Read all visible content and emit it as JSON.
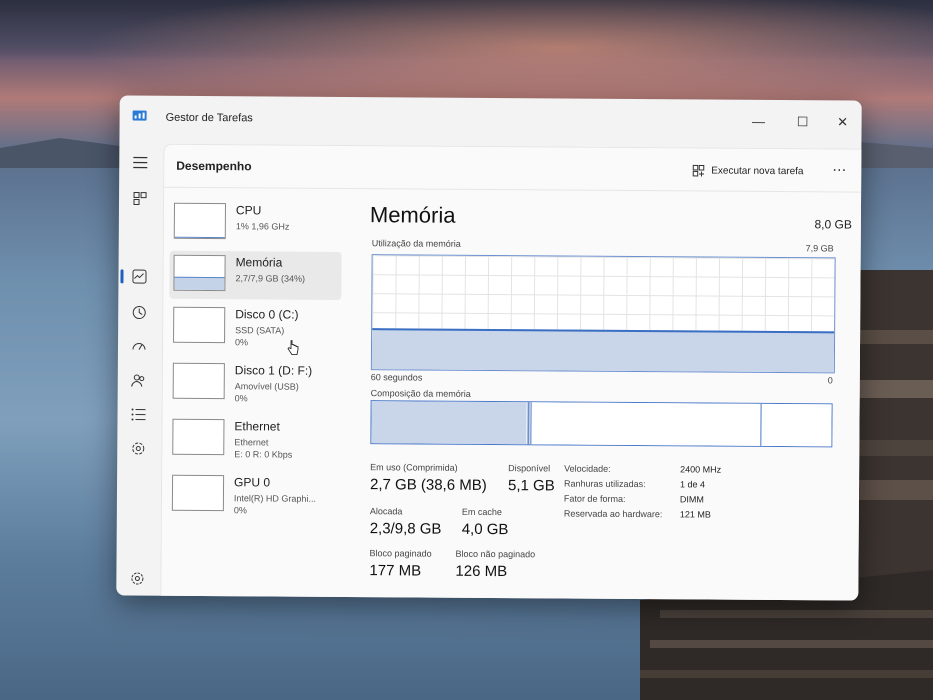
{
  "window": {
    "title": "Gestor de Tarefas",
    "minimize": "—",
    "maximize": "☐",
    "close": "✕"
  },
  "header": {
    "page_title": "Desempenho",
    "run_task_label": "Executar nova tarefa",
    "more": "⋯"
  },
  "resources": [
    {
      "name": "CPU",
      "sub1": "1% 1,96 GHz",
      "sub2": "",
      "usage": 0.01
    },
    {
      "name": "Memória",
      "sub1": "2,7/7,9 GB (34%)",
      "sub2": "",
      "usage": 0.34
    },
    {
      "name": "Disco 0 (C:)",
      "sub1": "SSD (SATA)",
      "sub2": "0%",
      "usage": 0
    },
    {
      "name": "Disco 1 (D: F:)",
      "sub1": "Amovível (USB)",
      "sub2": "0%",
      "usage": 0
    },
    {
      "name": "Ethernet",
      "sub1": "Ethernet",
      "sub2": "E: 0 R: 0 Kbps",
      "usage": 0
    },
    {
      "name": "GPU 0",
      "sub1": "Intel(R) HD Graphi...",
      "sub2": "0%",
      "usage": 0
    }
  ],
  "detail": {
    "title": "Memória",
    "total": "8,0 GB",
    "usage_label": "Utilização da memória",
    "usage_max": "7,9 GB",
    "time_left": "60 segundos",
    "time_right": "0",
    "usage_level": 0.34,
    "composition_label": "Composição da memória",
    "composition": {
      "in_use": 0.34,
      "modified": 0.006,
      "standby": 0.5,
      "free": 0.154
    },
    "stats": {
      "in_use_label": "Em uso (Comprimida)",
      "in_use_value": "2,7 GB (38,6 MB)",
      "available_label": "Disponível",
      "available_value": "5,1 GB",
      "committed_label": "Alocada",
      "committed_value": "2,3/9,8 GB",
      "cached_label": "Em cache",
      "cached_value": "4,0 GB",
      "paged_label": "Bloco paginado",
      "paged_value": "177 MB",
      "nonpaged_label": "Bloco não paginado",
      "nonpaged_value": "126 MB"
    },
    "specs": [
      {
        "k": "Velocidade:",
        "v": "2400 MHz"
      },
      {
        "k": "Ranhuras utilizadas:",
        "v": "1 de 4"
      },
      {
        "k": "Fator de forma:",
        "v": "DIMM"
      },
      {
        "k": "Reservada ao hardware:",
        "v": "121 MB"
      }
    ]
  },
  "colors": {
    "accent": "#1f5fbf",
    "graph_fill": "#c9d6ea",
    "graph_line": "#3a6fc4"
  }
}
